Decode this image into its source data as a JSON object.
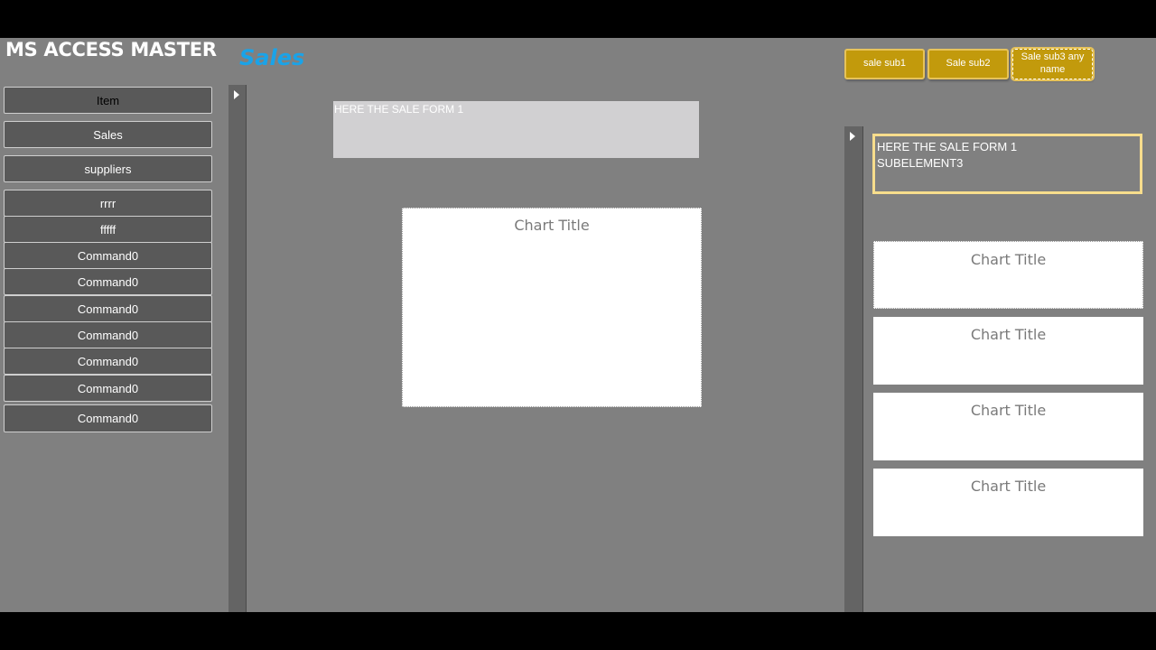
{
  "header": {
    "app_title": "MS ACCESS MASTER",
    "form_title": "Sales"
  },
  "nav": {
    "items": [
      {
        "label": "Item"
      },
      {
        "label": "Sales"
      },
      {
        "label": "suppliers"
      },
      {
        "label": "rrrr"
      },
      {
        "label": "fffff"
      },
      {
        "label": "Command0"
      },
      {
        "label": "Command0"
      },
      {
        "label": "Command0"
      },
      {
        "label": "Command0"
      },
      {
        "label": "Command0"
      },
      {
        "label": "Command0"
      },
      {
        "label": "Command0"
      }
    ]
  },
  "sub_buttons": {
    "sub1": "sale sub1",
    "sub2": "Sale sub2",
    "sub3": "Sale sub3 any name"
  },
  "main": {
    "subform_label": "HERE THE SALE FORM 1",
    "chart_title": "Chart Title"
  },
  "right": {
    "subform_label": "HERE THE SALE FORM 1\nSUBELEMENT3",
    "charts": [
      {
        "title": "Chart Title"
      },
      {
        "title": "Chart Title"
      },
      {
        "title": "Chart Title"
      },
      {
        "title": "Chart Title"
      }
    ]
  },
  "colors": {
    "accent_title": "#1aa3e8",
    "sub_button": "#c29a0c",
    "sub_border": "#f7dd8c",
    "background": "#808080"
  }
}
